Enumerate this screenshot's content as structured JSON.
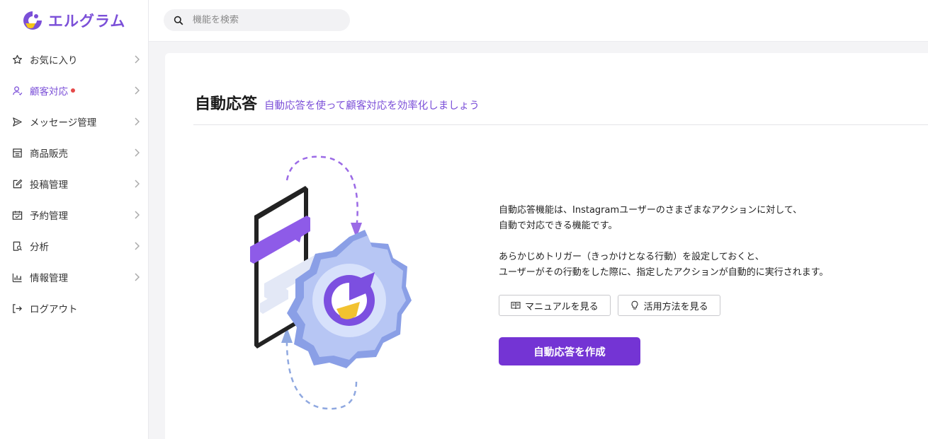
{
  "brand": {
    "name": "エルグラム",
    "color": "#7b4fd8"
  },
  "search": {
    "placeholder": "機能を検索"
  },
  "sidebar": {
    "items": [
      {
        "label": "お気に入り",
        "icon": "star-icon"
      },
      {
        "label": "顧客対応",
        "icon": "user-icon",
        "active": true,
        "badge_dot": true
      },
      {
        "label": "メッセージ管理",
        "icon": "send-icon"
      },
      {
        "label": "商品販売",
        "icon": "store-icon"
      },
      {
        "label": "投稿管理",
        "icon": "edit-icon"
      },
      {
        "label": "予約管理",
        "icon": "calendar-icon"
      },
      {
        "label": "分析",
        "icon": "document-search-icon"
      },
      {
        "label": "情報管理",
        "icon": "bar-chart-icon"
      },
      {
        "label": "ログアウト",
        "icon": "logout-icon"
      }
    ]
  },
  "main": {
    "title": "自動応答",
    "subtitle": "自動応答を使って顧客対応を効率化しましょう",
    "description": {
      "line1": "自動応答機能は、Instagramユーザーのさまざまなアクションに対して、",
      "line2": "自動で対応できる機能です。",
      "line3": "あらかじめトリガー（きっかけとなる行動）を設定しておくと、",
      "line4": "ユーザーがその行動をした際に、指定したアクションが自動的に実行されます。"
    },
    "buttons": {
      "manual": "マニュアルを見る",
      "usage": "活用方法を見る",
      "create": "自動応答を作成"
    }
  },
  "colors": {
    "accent": "#7434d4",
    "badge": "#e54a4a"
  }
}
